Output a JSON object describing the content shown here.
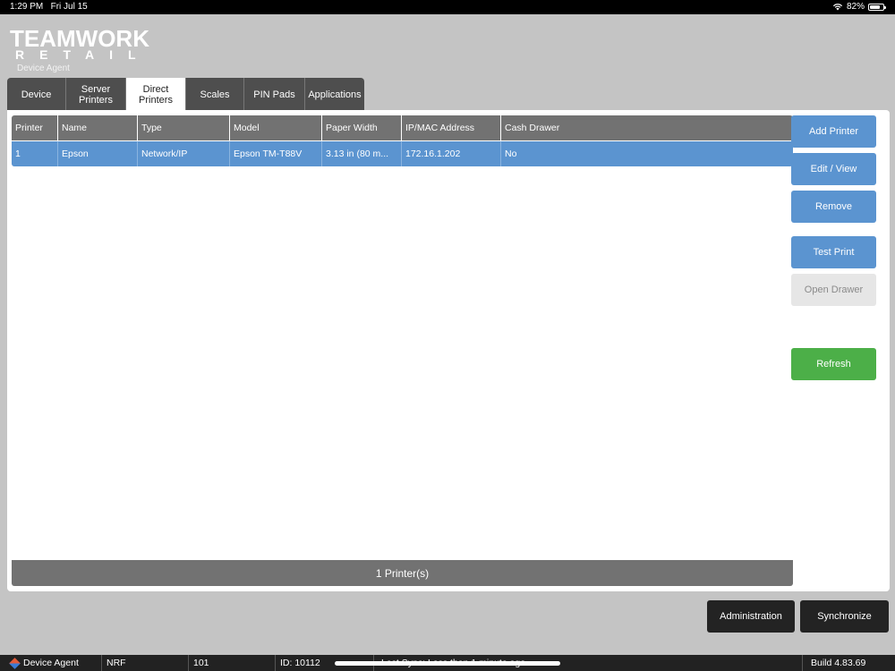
{
  "status_bar": {
    "time": "1:29 PM",
    "date": "Fri Jul 15",
    "battery": "82%",
    "battery_level": 0.82
  },
  "logo": {
    "line1": "TEAMWORK",
    "line2": "RETAIL",
    "subtitle": "Device Agent"
  },
  "tabs": [
    {
      "label": "Device",
      "active": false
    },
    {
      "label": "Server Printers",
      "active": false
    },
    {
      "label": "Direct Printers",
      "active": true
    },
    {
      "label": "Scales",
      "active": false
    },
    {
      "label": "PIN Pads",
      "active": false
    },
    {
      "label": "Applications",
      "active": false
    }
  ],
  "table": {
    "columns": [
      "Printer",
      "Name",
      "Type",
      "Model",
      "Paper Width",
      "IP/MAC Address",
      "Cash Drawer"
    ],
    "rows": [
      [
        "1",
        "Epson",
        "Network/IP",
        "Epson TM-T88V",
        "3.13 in (80 m...",
        "172.16.1.202",
        "No"
      ]
    ],
    "footer": "1 Printer(s)"
  },
  "buttons": {
    "add_printer": "Add Printer",
    "edit_view": "Edit / View",
    "remove": "Remove",
    "test_print": "Test Print",
    "open_drawer": "Open Drawer",
    "refresh": "Refresh",
    "administration": "Administration",
    "synchronize": "Synchronize"
  },
  "bottom_bar": {
    "app": "Device Agent",
    "location": "NRF",
    "store": "101",
    "id": "ID: 10112",
    "last_sync": "Last Sync: Less than 1 minute ago",
    "build": "Build 4.83.69"
  },
  "colors": {
    "accent_blue": "#5b94d0",
    "refresh_green": "#4caf48",
    "header_gray": "#727272",
    "dark_button": "#232323"
  }
}
